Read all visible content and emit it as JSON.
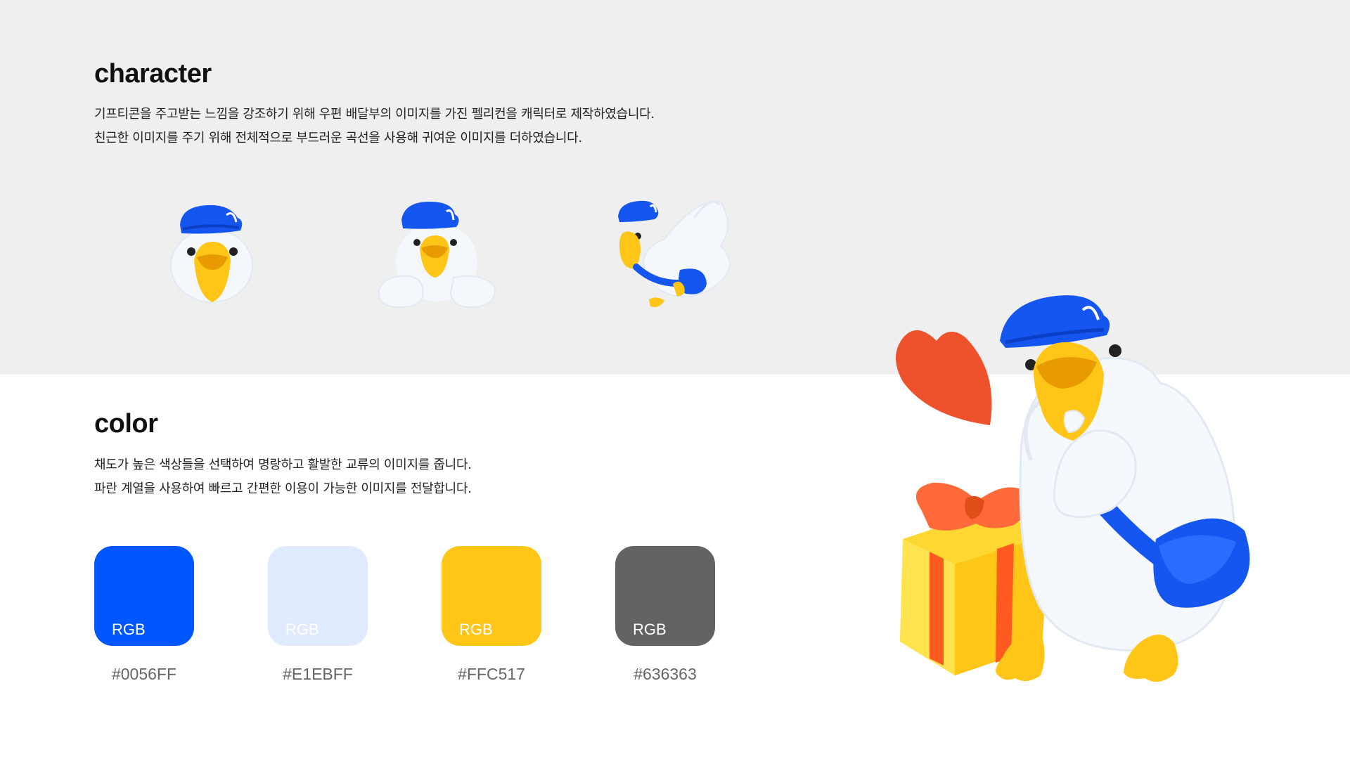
{
  "character": {
    "title": "character",
    "lines": [
      "기프티콘을 주고받는 느낌을 강조하기 위해 우편 배달부의 이미지를 가진 펠리컨을 캐릭터로 제작하였습니다.",
      "친근한 이미지를 주기 위해 전체적으로 부드러운 곡선을 사용해 귀여운 이미지를 더하였습니다."
    ],
    "poses": [
      "pelican-face-icon",
      "pelican-peek-icon",
      "pelican-flying-icon"
    ]
  },
  "color": {
    "title": "color",
    "lines": [
      "채도가 높은 색상들을 선택하여 명랑하고 활발한 교류의 이미지를 줍니다.",
      "파란 계열을 사용하여 빠르고 간편한 이용이 가능한 이미지를 전달합니다."
    ],
    "swatches": [
      {
        "label": "RGB",
        "hex": "#0056FF",
        "color": "#0056FF",
        "text_color": "#ffffff"
      },
      {
        "label": "RGB",
        "hex": "#E1EBFF",
        "color": "#E1EBFF",
        "text_color": "#ffffff"
      },
      {
        "label": "RGB",
        "hex": "#FFC517",
        "color": "#FFC517",
        "text_color": "#ffffff"
      },
      {
        "label": "RGB",
        "hex": "#636363",
        "color": "#636363",
        "text_color": "#ffffff"
      }
    ]
  },
  "illustration": {
    "items": [
      "pelican-mascot-icon",
      "heart-icon",
      "gift-box-icon"
    ]
  }
}
